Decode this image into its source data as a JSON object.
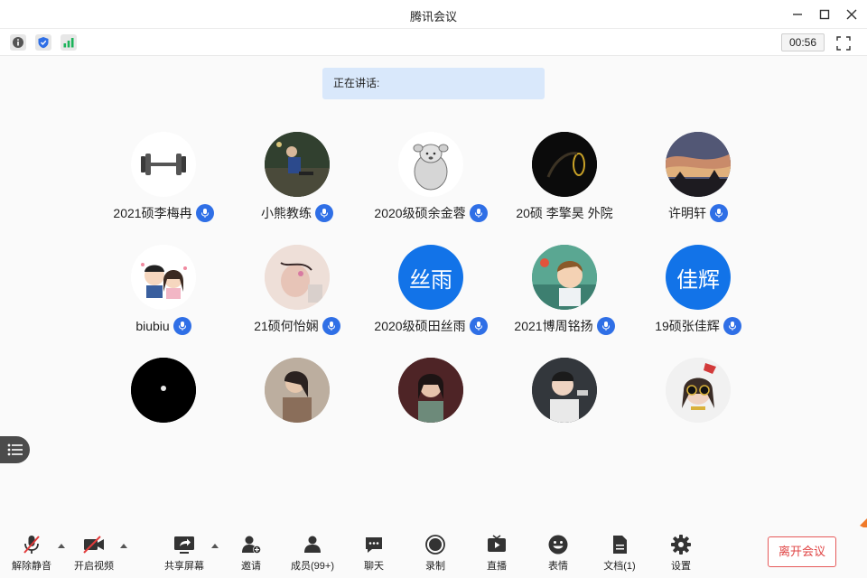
{
  "window": {
    "title": "腾讯会议"
  },
  "infobar": {
    "timer": "00:56"
  },
  "speaking": {
    "label": "正在讲话:"
  },
  "participants": [
    {
      "name": "2021硕李梅冉",
      "avatar": "dumbbell-avatar",
      "mic": true
    },
    {
      "name": "小熊教练",
      "avatar": "photo-avatar",
      "mic": true
    },
    {
      "name": "2020级硕余金蓉",
      "avatar": "dog-sketch-avatar",
      "mic": true
    },
    {
      "name": "20硕 李擎昊 外院",
      "avatar": "dark-photo-avatar",
      "mic": false
    },
    {
      "name": "许明轩",
      "avatar": "sunset-avatar",
      "mic": true
    },
    {
      "name": "biubiu",
      "avatar": "cartoon-couple-avatar",
      "mic": true
    },
    {
      "name": "21硕何怡娴",
      "avatar": "photo-avatar",
      "mic": true
    },
    {
      "name": "2020级硕田丝雨",
      "avatar_text": "丝雨",
      "mic": true
    },
    {
      "name": "2021博周铭扬",
      "avatar": "anime-avatar",
      "mic": true
    },
    {
      "name": "19硕张佳辉",
      "avatar_text": "佳辉",
      "mic": true
    },
    {
      "name": "",
      "avatar": "black-dot-avatar",
      "mic": false
    },
    {
      "name": "",
      "avatar": "photo-avatar",
      "mic": false
    },
    {
      "name": "",
      "avatar": "photo-avatar",
      "mic": false
    },
    {
      "name": "",
      "avatar": "photo-avatar",
      "mic": false
    },
    {
      "name": "",
      "avatar": "sunglasses-avatar",
      "mic": false
    }
  ],
  "toolbar": {
    "unmute": "解除静音",
    "start_video": "开启视频",
    "share_screen": "共享屏幕",
    "invite": "邀请",
    "members": "成员(99+)",
    "chat": "聊天",
    "record": "录制",
    "live": "直播",
    "emoji": "表情",
    "docs": "文档(1)",
    "settings": "设置",
    "leave": "离开会议"
  },
  "colors": {
    "accent": "#2f6fe6",
    "avatar_blue": "#1273e8",
    "leave_red": "#e04545",
    "speaking_bg": "#d9e8fb"
  }
}
